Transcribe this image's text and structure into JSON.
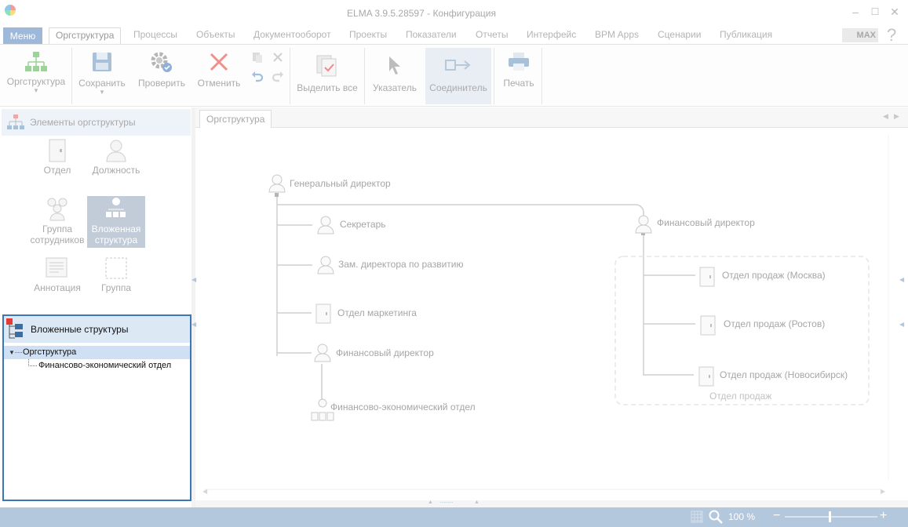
{
  "window": {
    "title": "ELMA 3.9.5.28597 - Конфигурация"
  },
  "menu": {
    "menu_button": "Меню",
    "tabs": [
      "Оргструктура",
      "Процессы",
      "Объекты",
      "Документооборот",
      "Проекты",
      "Показатели",
      "Отчеты",
      "Интерфейс",
      "BPM Apps",
      "Сценарии",
      "Публикация"
    ],
    "active_tab": "Оргструктура",
    "max_badge": "MAX",
    "help": "?"
  },
  "ribbon": {
    "orgstructure": "Оргструктура",
    "save": "Сохранить",
    "check": "Проверить",
    "cancel": "Отменить",
    "select_all": "Выделить все",
    "pointer": "Указатель",
    "connector": "Соединитель",
    "print": "Печать"
  },
  "elements_panel": {
    "header": "Элементы оргструктуры",
    "items": {
      "department": "Отдел",
      "position": "Должность",
      "group_employees_1": "Группа",
      "group_employees_2": "сотрудников",
      "nested_1": "Вложенная",
      "nested_2": "структура",
      "annotation": "Аннотация",
      "group": "Группа"
    }
  },
  "nested_panel": {
    "header": "Вложенные структуры",
    "tree": {
      "root": "Оргструктура",
      "child": "Финансово-экономический отдел"
    }
  },
  "canvas": {
    "tab": "Оргструктура",
    "nodes": {
      "ceo": "Генеральный директор",
      "secretary": "Секретарь",
      "deputy": "Зам. директора по развитию",
      "marketing": "Отдел маркетинга",
      "cfo_left": "Финансовый директор",
      "fin_econ": "Финансово-экономический отдел",
      "cfo_right": "Финансовый директор",
      "sales_moscow": "Отдел продаж (Москва)",
      "sales_rostov": "Отдел продаж (Ростов)",
      "sales_novosib": "Отдел продаж (Новосибирск)",
      "sales_group": "Отдел продаж"
    }
  },
  "status": {
    "zoom": "100 %"
  }
}
